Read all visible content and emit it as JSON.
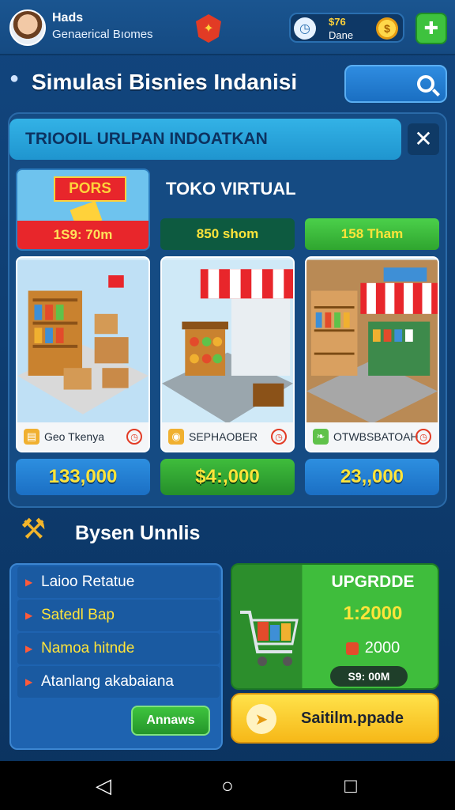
{
  "header": {
    "name": "Hads",
    "subtitle": "Genaerical Bıomes",
    "resource_value": "$76",
    "resource_label": "Dane"
  },
  "title": "Simulasi Bisnies Indanisi",
  "banner": "TRIOOIL URLPAN INDOATKAN",
  "promo": {
    "tag": "PORS",
    "strip": "1S9: 70m"
  },
  "toko_label": "TOKO VIRTUAL",
  "tabs": [
    {
      "label": "850 shom",
      "color": "#0d5a40"
    },
    {
      "label": "158 Tham",
      "color": "#3fc23c"
    }
  ],
  "cards": [
    {
      "name": "Geo Tkenya",
      "price": "133,000"
    },
    {
      "name": "SEPHAOBER",
      "price": "$4:,000"
    },
    {
      "name": "OTWBSBATOAH",
      "price": "23,,000"
    }
  ],
  "analysis": {
    "title": "Bysen Unnlis",
    "items": [
      "Laioo Retatue",
      "Satedl Bap",
      "Namoa hitnde",
      "Atanlang akabaiana"
    ],
    "button": "Annaws"
  },
  "upgrade": {
    "label": "UPGRDDE",
    "value": "1:2000",
    "cost": "2000",
    "price": "S9: 00M",
    "button": "Saitilm.ppade"
  },
  "colors": {
    "accent_green": "#3ec23e",
    "accent_yellow": "#ffd23a",
    "accent_red": "#e8262b"
  }
}
